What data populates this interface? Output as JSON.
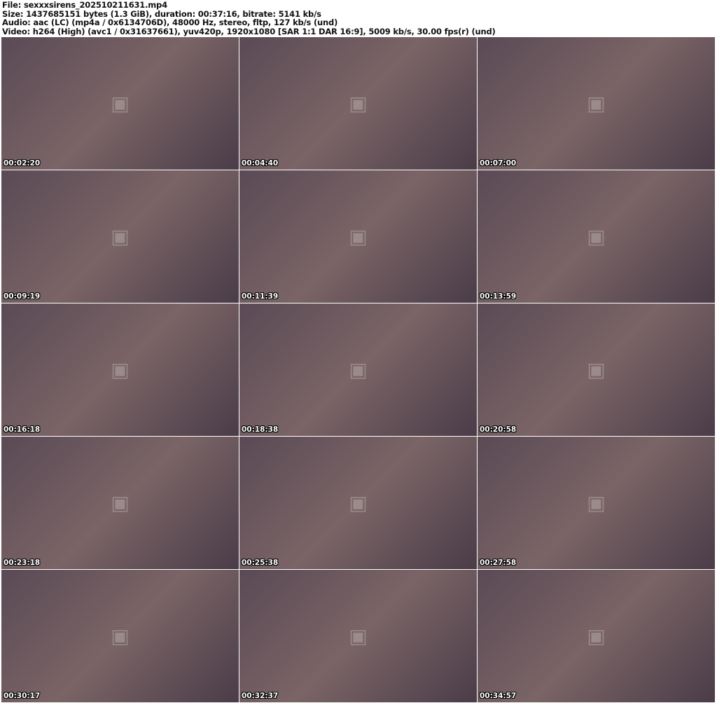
{
  "header": {
    "file": "File: sexxxsirens_202510211631.mp4",
    "size": "Size: 1437685151 bytes (1.3 GiB), duration: 00:37:16, bitrate: 5141 kb/s",
    "audio": "Audio: aac (LC) (mp4a / 0x6134706D), 48000 Hz, stereo, fltp, 127 kb/s (und)",
    "video": "Video: h264 (High) (avc1 / 0x31637661), yuv420p, 1920x1080 [SAR 1:1 DAR 16:9], 5009 kb/s, 30.00 fps(r) (und)"
  },
  "thumbnails": [
    {
      "timestamp": "00:02:20"
    },
    {
      "timestamp": "00:04:40"
    },
    {
      "timestamp": "00:07:00"
    },
    {
      "timestamp": "00:09:19"
    },
    {
      "timestamp": "00:11:39"
    },
    {
      "timestamp": "00:13:59"
    },
    {
      "timestamp": "00:16:18"
    },
    {
      "timestamp": "00:18:38"
    },
    {
      "timestamp": "00:20:58"
    },
    {
      "timestamp": "00:23:18"
    },
    {
      "timestamp": "00:25:38"
    },
    {
      "timestamp": "00:27:58"
    },
    {
      "timestamp": "00:30:17"
    },
    {
      "timestamp": "00:32:37"
    },
    {
      "timestamp": "00:34:57"
    }
  ]
}
